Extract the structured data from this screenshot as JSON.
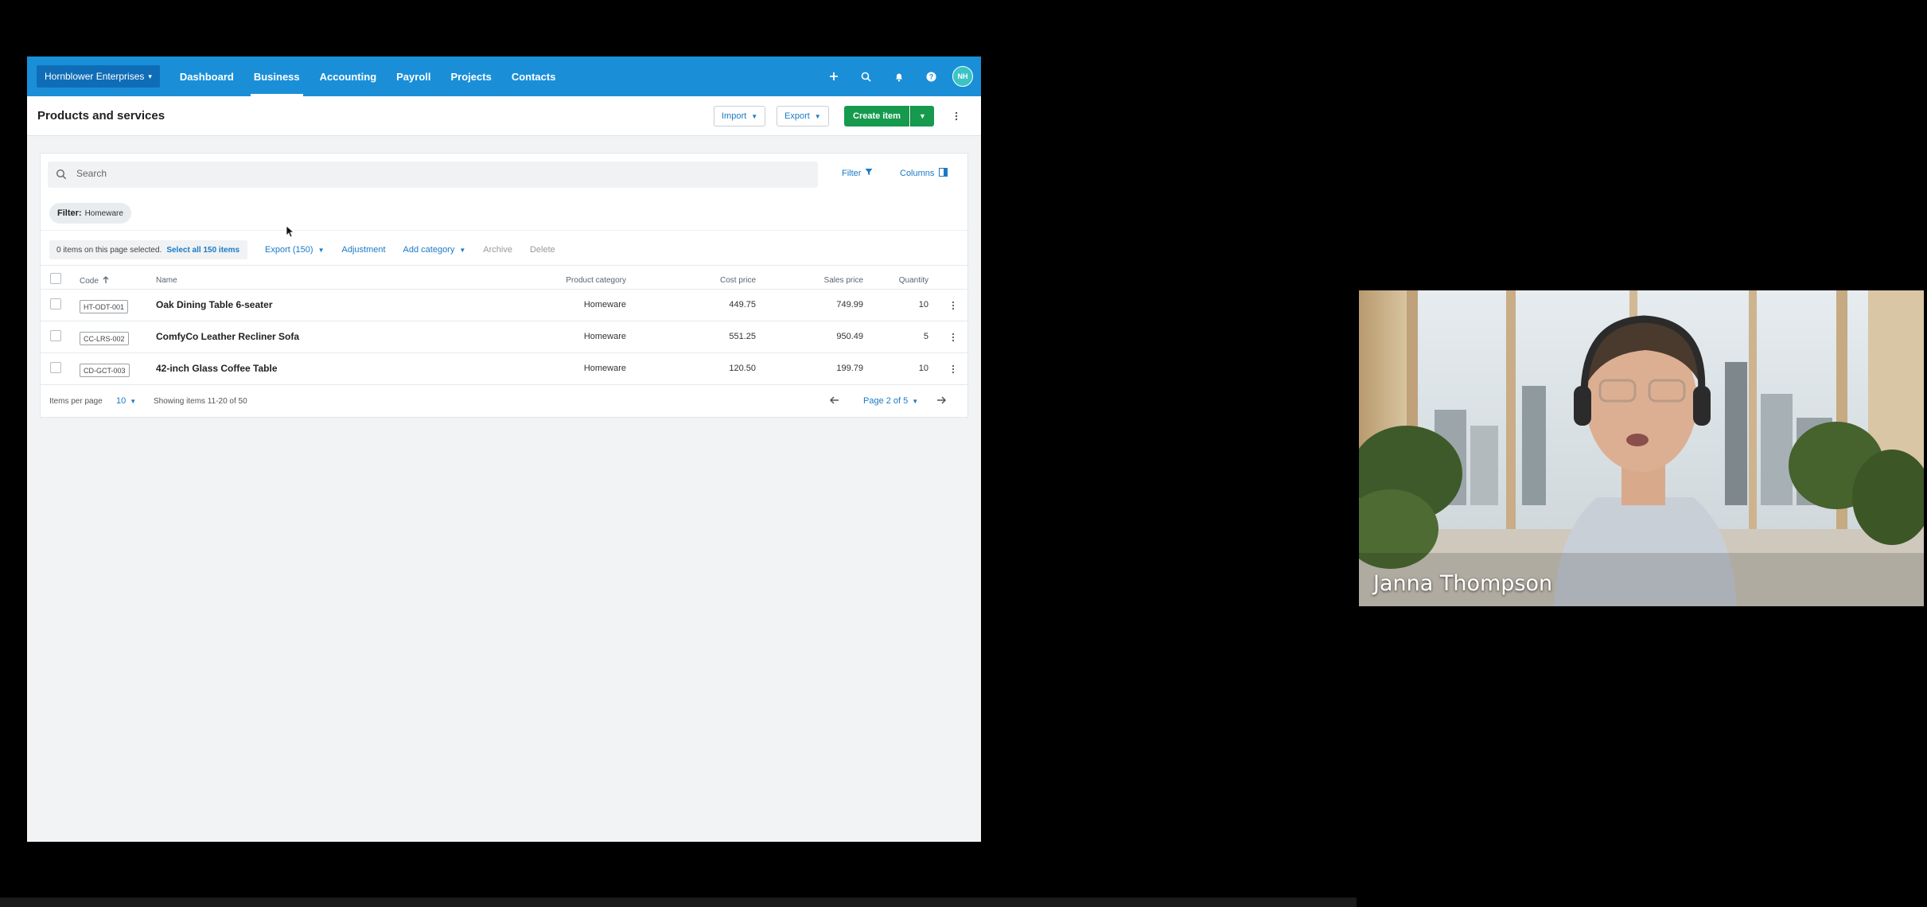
{
  "app": {
    "nav": {
      "org": "Hornblower Enterprises",
      "links": [
        {
          "label": "Dashboard",
          "active": false
        },
        {
          "label": "Business",
          "active": true
        },
        {
          "label": "Accounting",
          "active": false
        },
        {
          "label": "Payroll",
          "active": false
        },
        {
          "label": "Projects",
          "active": false
        },
        {
          "label": "Contacts",
          "active": false
        }
      ],
      "avatar_initials": "NH",
      "icons": [
        "plus-icon",
        "search-icon",
        "bell-icon",
        "help-icon"
      ],
      "brand_color": "#1a8fd8"
    },
    "page": {
      "title": "Products and services",
      "import_label": "Import",
      "export_label": "Export",
      "create_label": "Create item"
    },
    "search": {
      "placeholder": "Search"
    },
    "filter_label": "Filter",
    "columns_label": "Columns",
    "filter_chip": {
      "key": "Filter:",
      "value": "Homeware"
    },
    "selection": {
      "info": "0 items on this page selected.",
      "select_all": "Select all 150 items",
      "export": "Export (150)",
      "adjustment": "Adjustment",
      "add_category": "Add category",
      "archive": "Archive",
      "delete": "Delete"
    },
    "table": {
      "headers": {
        "code": "Code",
        "name": "Name",
        "category": "Product category",
        "cost": "Cost price",
        "sale": "Sales price",
        "qty": "Quantity"
      },
      "rows": [
        {
          "code": "HT-ODT-001",
          "name": "Oak Dining Table 6-seater",
          "category": "Homeware",
          "cost": "449.75",
          "sale": "749.99",
          "qty": "10"
        },
        {
          "code": "CC-LRS-002",
          "name": "ComfyCo Leather Recliner Sofa",
          "category": "Homeware",
          "cost": "551.25",
          "sale": "950.49",
          "qty": "5"
        },
        {
          "code": "CD-GCT-003",
          "name": "42-inch Glass Coffee Table",
          "category": "Homeware",
          "cost": "120.50",
          "sale": "199.79",
          "qty": "10"
        }
      ]
    },
    "footer": {
      "items_per_page_label": "Items per page",
      "items_per_page": "10",
      "showing": "Showing items 11-20 of 50",
      "page": "Page 2 of 5"
    }
  },
  "video": {
    "participant_name": "Janna Thompson"
  }
}
